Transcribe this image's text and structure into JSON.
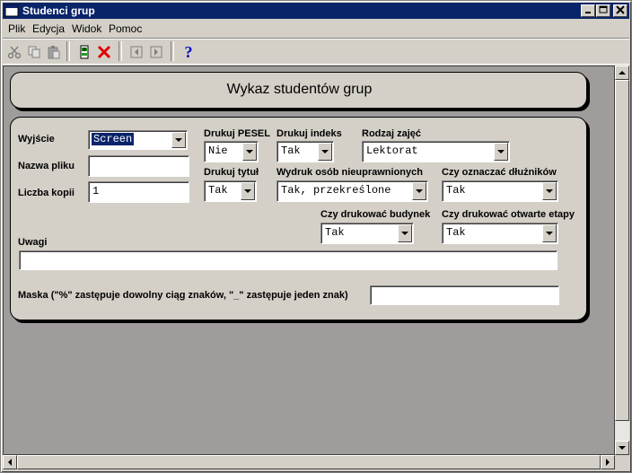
{
  "window": {
    "title": "Studenci grup"
  },
  "menu": [
    {
      "label": "Plik"
    },
    {
      "label": "Edycja"
    },
    {
      "label": "Widok"
    },
    {
      "label": "Pomoc"
    }
  ],
  "toolbar": {
    "icons": [
      "scissors-icon",
      "copy-icon",
      "paste-icon",
      "print-icon",
      "delete-icon",
      "prev-icon",
      "next-icon",
      "help-icon"
    ],
    "help_glyph": "?"
  },
  "header": {
    "title": "Wykaz studentów grup"
  },
  "form": {
    "wyjscie": {
      "label": "Wyjście",
      "value": "Screen"
    },
    "nazwa_pliku": {
      "label": "Nazwa pliku",
      "value": ""
    },
    "liczba_kopii": {
      "label": "Liczba kopii",
      "value": "1"
    },
    "drukuj_pesel": {
      "label": "Drukuj PESEL",
      "value": "Nie"
    },
    "drukuj_indeks": {
      "label": "Drukuj indeks",
      "value": "Tak"
    },
    "rodzaj_zajec": {
      "label": "Rodzaj zajęć",
      "value": "Lektorat"
    },
    "drukuj_tytul": {
      "label": "Drukuj tytuł",
      "value": "Tak"
    },
    "wydruk_osob": {
      "label": "Wydruk osób nieuprawnionych",
      "value": "Tak, przekreślone"
    },
    "dluznicy": {
      "label": "Czy oznaczać dłużników",
      "value": "Tak"
    },
    "budynek": {
      "label": "Czy drukować budynek",
      "value": "Tak"
    },
    "etapy": {
      "label": "Czy drukować otwarte etapy",
      "value": "Tak"
    },
    "uwagi": {
      "label": "Uwagi",
      "value": ""
    },
    "maska": {
      "label": "Maska (\"%\" zastępuje dowolny ciąg znaków, \"_\" zastępuje jeden znak)",
      "value": ""
    }
  },
  "colors": {
    "titlebar": "#0a246a",
    "face": "#d4d0c8",
    "client": "#a09c9c"
  }
}
